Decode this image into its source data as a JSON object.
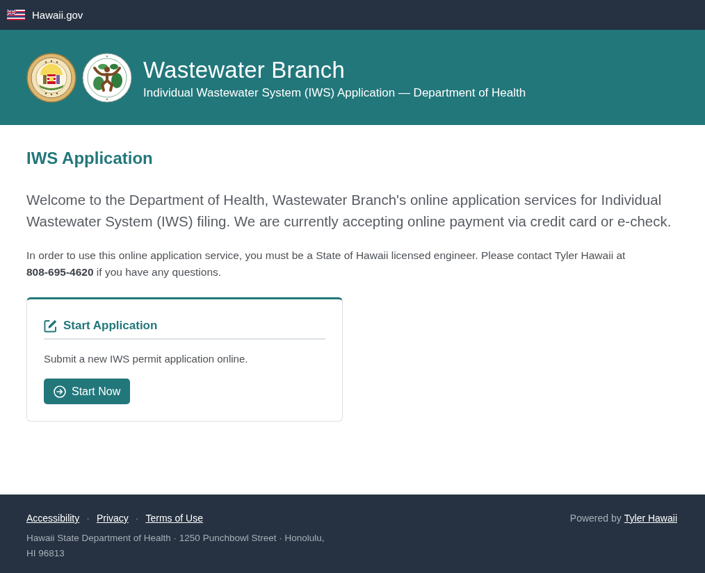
{
  "top_bar": {
    "label": "Hawaii.gov"
  },
  "header": {
    "title": "Wastewater Branch",
    "subtitle": "Individual Wastewater System (IWS) Application — Department of Health"
  },
  "main": {
    "heading": "IWS Application",
    "intro": "Welcome to the Department of Health, Wastewater Branch's online application services for Individual Wastewater System (IWS) filing. We are currently accepting online payment via credit card or e-check.",
    "notice": "In order to use this online application service, you must be a State of Hawaii licensed engineer. Please contact Tyler Hawaii at **808-695-4620** if you have any questions."
  },
  "card": {
    "title": "Start Application",
    "text": "Submit a new IWS permit application online.",
    "button": "Start Now"
  },
  "footer": {
    "nav": [
      {
        "kind": "link",
        "label": "Accessibility"
      },
      {
        "kind": "separator",
        "label": "·"
      },
      {
        "kind": "link",
        "label": "Privacy"
      },
      {
        "kind": "separator",
        "label": "·"
      },
      {
        "kind": "link",
        "label": "Terms of Use"
      }
    ],
    "address": "Hawaii State Department of Health · 1250 Punchbowl Street · Honolulu, HI 96813",
    "powered_by": {
      "label": "Powered by",
      "link": "Tyler Hawaii"
    }
  }
}
